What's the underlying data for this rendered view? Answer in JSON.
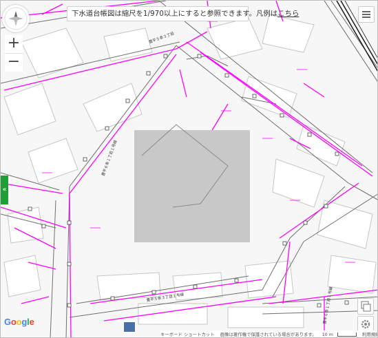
{
  "notice": {
    "text": "下水道台帳図は縮尺を1/970以上にすると参照できます。凡例は",
    "link_label": "こちら"
  },
  "zoom": {
    "in_label": "+",
    "out_label": "−"
  },
  "side_tab": {
    "label": "«"
  },
  "google": {
    "letters": [
      "G",
      "o",
      "o",
      "g",
      "l",
      "e"
    ]
  },
  "attribution": {
    "keyboard": "キーボード ショートカット",
    "imagery": "画像は著作権で保護されている場合があります。",
    "scale": "10 m",
    "terms": "利用規約"
  },
  "map": {
    "labels": [
      "豊平５条３丁目",
      "豊平６条１丁目１号線",
      "豊平５条３丁目１号線",
      "豊平６条１丁目１号線"
    ],
    "colors": {
      "sewer": "#ff00ff",
      "roads": "#6e6e6e",
      "buildings": "#c6c6c6",
      "block": "#c8c8c8",
      "rail": "#1a1a1a"
    }
  }
}
